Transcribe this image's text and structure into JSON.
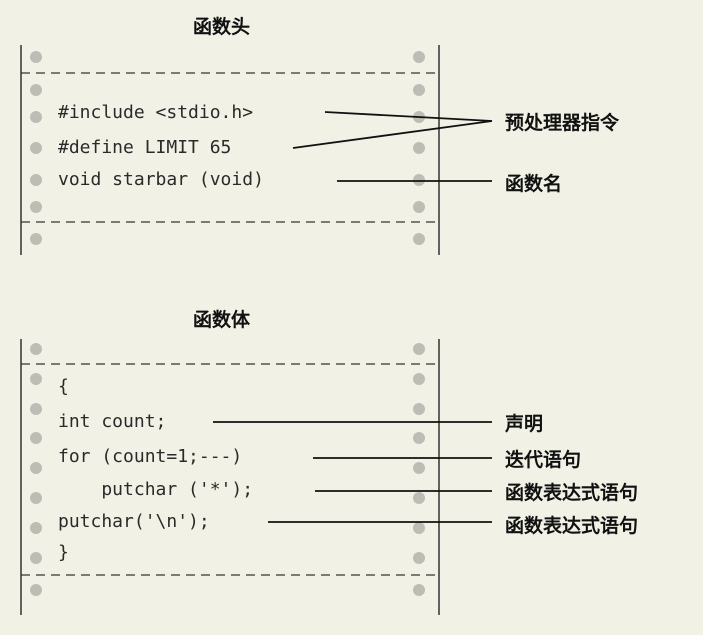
{
  "header": {
    "title": "函数头",
    "lines": [
      "#include <stdio.h>",
      "#define LIMIT 65",
      "void starbar (void)"
    ],
    "labels": [
      "预处理器指令",
      "函数名"
    ]
  },
  "body": {
    "title": "函数体",
    "lines": [
      "{",
      "int count;",
      "for (count=1;---)",
      "    putchar ('*');",
      "putchar('\\n');",
      "}"
    ],
    "labels": [
      "声明",
      "迭代语句",
      "函数表达式语句",
      "函数表达式语句"
    ]
  }
}
